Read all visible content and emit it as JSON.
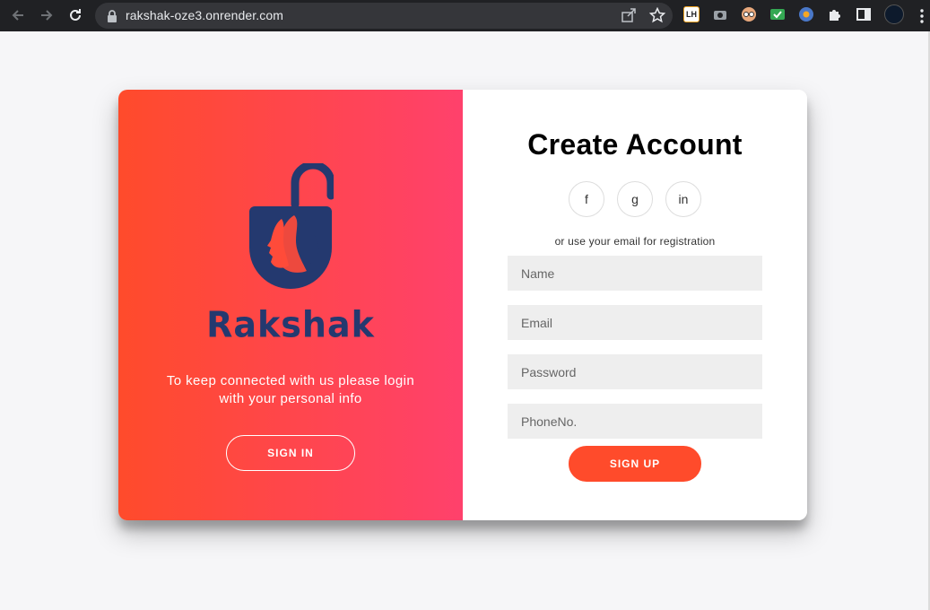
{
  "browser": {
    "url": "rakshak-oze3.onrender.com",
    "icons": [
      "back-icon",
      "forward-icon",
      "reload-icon",
      "lock-icon",
      "share-icon",
      "star-icon",
      "extensions-icon",
      "sidepanel-icon",
      "menu-icon"
    ],
    "extensions": [
      "LH"
    ]
  },
  "signin_panel": {
    "brand": "Rakshak",
    "message": "To keep connected with us please login with your personal info",
    "signin_label": "SIGN IN"
  },
  "signup_panel": {
    "title": "Create Account",
    "socials": [
      "f",
      "g",
      "in"
    ],
    "hint": "or use your email for registration",
    "fields": {
      "name_placeholder": "Name",
      "email_placeholder": "Email",
      "password_placeholder": "Password",
      "phone_placeholder": "PhoneNo."
    },
    "signup_label": "SIGN UP"
  },
  "colors": {
    "gradient_start": "#ff4b2b",
    "gradient_end": "#ff416c",
    "brand": "#24396f",
    "accent": "#ff4b2b"
  }
}
